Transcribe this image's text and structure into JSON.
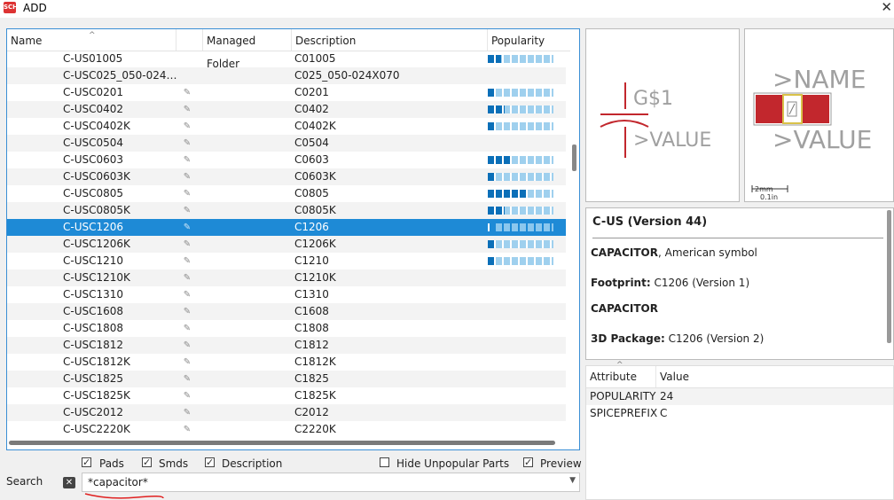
{
  "window": {
    "title": "ADD",
    "close_icon": "close-icon",
    "app_icon": "eagle-app-icon"
  },
  "table": {
    "columns": {
      "name": "Name",
      "managed_folder": "Managed Folder",
      "description": "Description",
      "popularity": "Popularity"
    },
    "rows": [
      {
        "name": "C-US01005",
        "desc": "C01005",
        "icon": false,
        "pop": 0.2
      },
      {
        "name": "C-USC025_050-024…",
        "desc": "C025_050-024X070",
        "icon": false,
        "pop": null
      },
      {
        "name": "C-USC0201",
        "desc": "C0201",
        "icon": true,
        "pop": 0.1
      },
      {
        "name": "C-USC0402",
        "desc": "C0402",
        "icon": true,
        "pop": 0.25
      },
      {
        "name": "C-USC0402K",
        "desc": "C0402K",
        "icon": true,
        "pop": 0.1
      },
      {
        "name": "C-USC0504",
        "desc": "C0504",
        "icon": true,
        "pop": null
      },
      {
        "name": "C-USC0603",
        "desc": "C0603",
        "icon": true,
        "pop": 0.35
      },
      {
        "name": "C-USC0603K",
        "desc": "C0603K",
        "icon": true,
        "pop": 0.1
      },
      {
        "name": "C-USC0805",
        "desc": "C0805",
        "icon": true,
        "pop": 0.6
      },
      {
        "name": "C-USC0805K",
        "desc": "C0805K",
        "icon": true,
        "pop": 0.25
      },
      {
        "name": "C-USC1206",
        "desc": "C1206",
        "icon": true,
        "pop": 0.1,
        "selected": true
      },
      {
        "name": "C-USC1206K",
        "desc": "C1206K",
        "icon": true,
        "pop": 0.1
      },
      {
        "name": "C-USC1210",
        "desc": "C1210",
        "icon": true,
        "pop": 0.1
      },
      {
        "name": "C-USC1210K",
        "desc": "C1210K",
        "icon": true,
        "pop": null
      },
      {
        "name": "C-USC1310",
        "desc": "C1310",
        "icon": true,
        "pop": null
      },
      {
        "name": "C-USC1608",
        "desc": "C1608",
        "icon": true,
        "pop": null
      },
      {
        "name": "C-USC1808",
        "desc": "C1808",
        "icon": true,
        "pop": null
      },
      {
        "name": "C-USC1812",
        "desc": "C1812",
        "icon": true,
        "pop": null
      },
      {
        "name": "C-USC1812K",
        "desc": "C1812K",
        "icon": true,
        "pop": null
      },
      {
        "name": "C-USC1825",
        "desc": "C1825",
        "icon": true,
        "pop": null
      },
      {
        "name": "C-USC1825K",
        "desc": "C1825K",
        "icon": true,
        "pop": null
      },
      {
        "name": "C-USC2012",
        "desc": "C2012",
        "icon": true,
        "pop": null
      },
      {
        "name": "C-USC2220K",
        "desc": "C2220K",
        "icon": true,
        "pop": null
      }
    ]
  },
  "options": {
    "pads": {
      "label": "Pads",
      "checked": true
    },
    "smds": {
      "label": "Smds",
      "checked": true
    },
    "description": {
      "label": "Description",
      "checked": true
    },
    "hide_unpopular": {
      "label": "Hide Unpopular Parts",
      "checked": false
    },
    "preview": {
      "label": "Preview",
      "checked": true
    }
  },
  "search": {
    "label": "Search",
    "value": "*capacitor*"
  },
  "symbol_preview": {
    "part_label": "G$1",
    "value_label": ">VALUE"
  },
  "package_preview": {
    "name_label": ">NAME",
    "value_label": ">VALUE",
    "scale_mm": "2mm",
    "scale_in": "0.1in"
  },
  "info": {
    "title": "C-US (Version 44)",
    "device_name": "CAPACITOR",
    "device_desc": ", American symbol",
    "footprint_label": "Footprint:",
    "footprint_value": " C1206 (Version 1)",
    "section": "CAPACITOR",
    "package3d_label": "3D Package:",
    "package3d_value": " C1206 (Version 2)"
  },
  "attributes": {
    "columns": {
      "attribute": "Attribute",
      "value": "Value"
    },
    "rows": [
      {
        "attribute": "POPULARITY",
        "value": "24"
      },
      {
        "attribute": "SPICEPREFIX",
        "value": "C"
      }
    ]
  },
  "colors": {
    "accent": "#1e8ad6",
    "symbol_red": "#c2272d"
  }
}
